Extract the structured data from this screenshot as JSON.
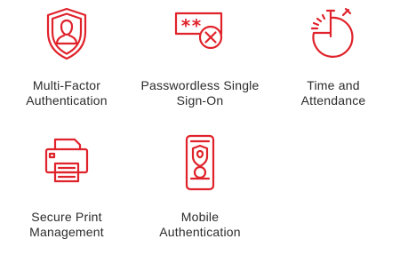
{
  "theme": {
    "icon_color": "#e0222b",
    "text_color": "#2b2b2b"
  },
  "features": [
    {
      "icon": "shield-user-icon",
      "line1": "Multi-Factor",
      "line2": "Authentication"
    },
    {
      "icon": "password-cancel-icon",
      "line1": "Passwordless Single",
      "line2": "Sign-On"
    },
    {
      "icon": "stopwatch-icon",
      "line1": "Time and",
      "line2": "Attendance"
    },
    {
      "icon": "printer-icon",
      "line1": "Secure Print",
      "line2": "Management"
    },
    {
      "icon": "mobile-badge-icon",
      "line1": "Mobile",
      "line2": "Authentication"
    }
  ],
  "password_mask": "**"
}
